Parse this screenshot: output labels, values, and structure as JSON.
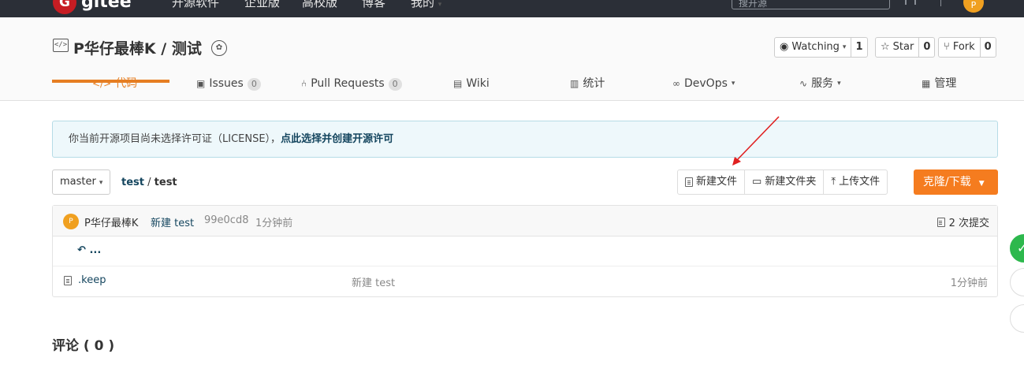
{
  "topnav": {
    "logo_letter": "G",
    "logo_text": "gitee",
    "items": [
      "开源软件",
      "企业版",
      "高校版",
      "博客",
      "我的"
    ],
    "search_placeholder": "搜开源",
    "avatar_letter": "P"
  },
  "project": {
    "title": "P华仔最棒K / 测试",
    "watch_label": "Watching",
    "watch_count": "1",
    "star_label": "Star",
    "star_count": "0",
    "fork_label": "Fork",
    "fork_count": "0"
  },
  "tabs": [
    {
      "label": "代码",
      "icon": "code-icon",
      "count": ""
    },
    {
      "label": "Issues",
      "icon": "issues-icon",
      "count": "0"
    },
    {
      "label": "Pull Requests",
      "icon": "pull-request-icon",
      "count": "0"
    },
    {
      "label": "Wiki",
      "icon": "wiki-icon",
      "count": ""
    },
    {
      "label": "统计",
      "icon": "stats-icon",
      "count": ""
    },
    {
      "label": "DevOps",
      "icon": "devops-icon",
      "count": ""
    },
    {
      "label": "服务",
      "icon": "service-icon",
      "count": ""
    },
    {
      "label": "管理",
      "icon": "manage-icon",
      "count": ""
    }
  ],
  "license": {
    "text": "你当前开源项目尚未选择许可证（LICENSE），",
    "link": "点此选择并创建开源许可"
  },
  "toolbar": {
    "branch": "master",
    "crumb_root": "test",
    "crumb_sep": "/",
    "crumb_current": "test",
    "new_file": "新建文件",
    "new_folder": "新建文件夹",
    "upload": "上传文件",
    "clone": "克隆/下载"
  },
  "commit": {
    "avatar_letter": "P",
    "author": "P华仔最棒K",
    "message": "新建 test",
    "sha": "99e0cd8",
    "time": "1分钟前",
    "count": "2 次提交"
  },
  "up_link": "...",
  "files": [
    {
      "name": ".keep",
      "message": "新建 test",
      "time": "1分钟前"
    }
  ],
  "comments_title": "评论 ( 0 )",
  "colors": {
    "accent": "#e67e22",
    "clone_button": "#f57c1f",
    "link": "#15465f",
    "annotation": "#e02020"
  }
}
